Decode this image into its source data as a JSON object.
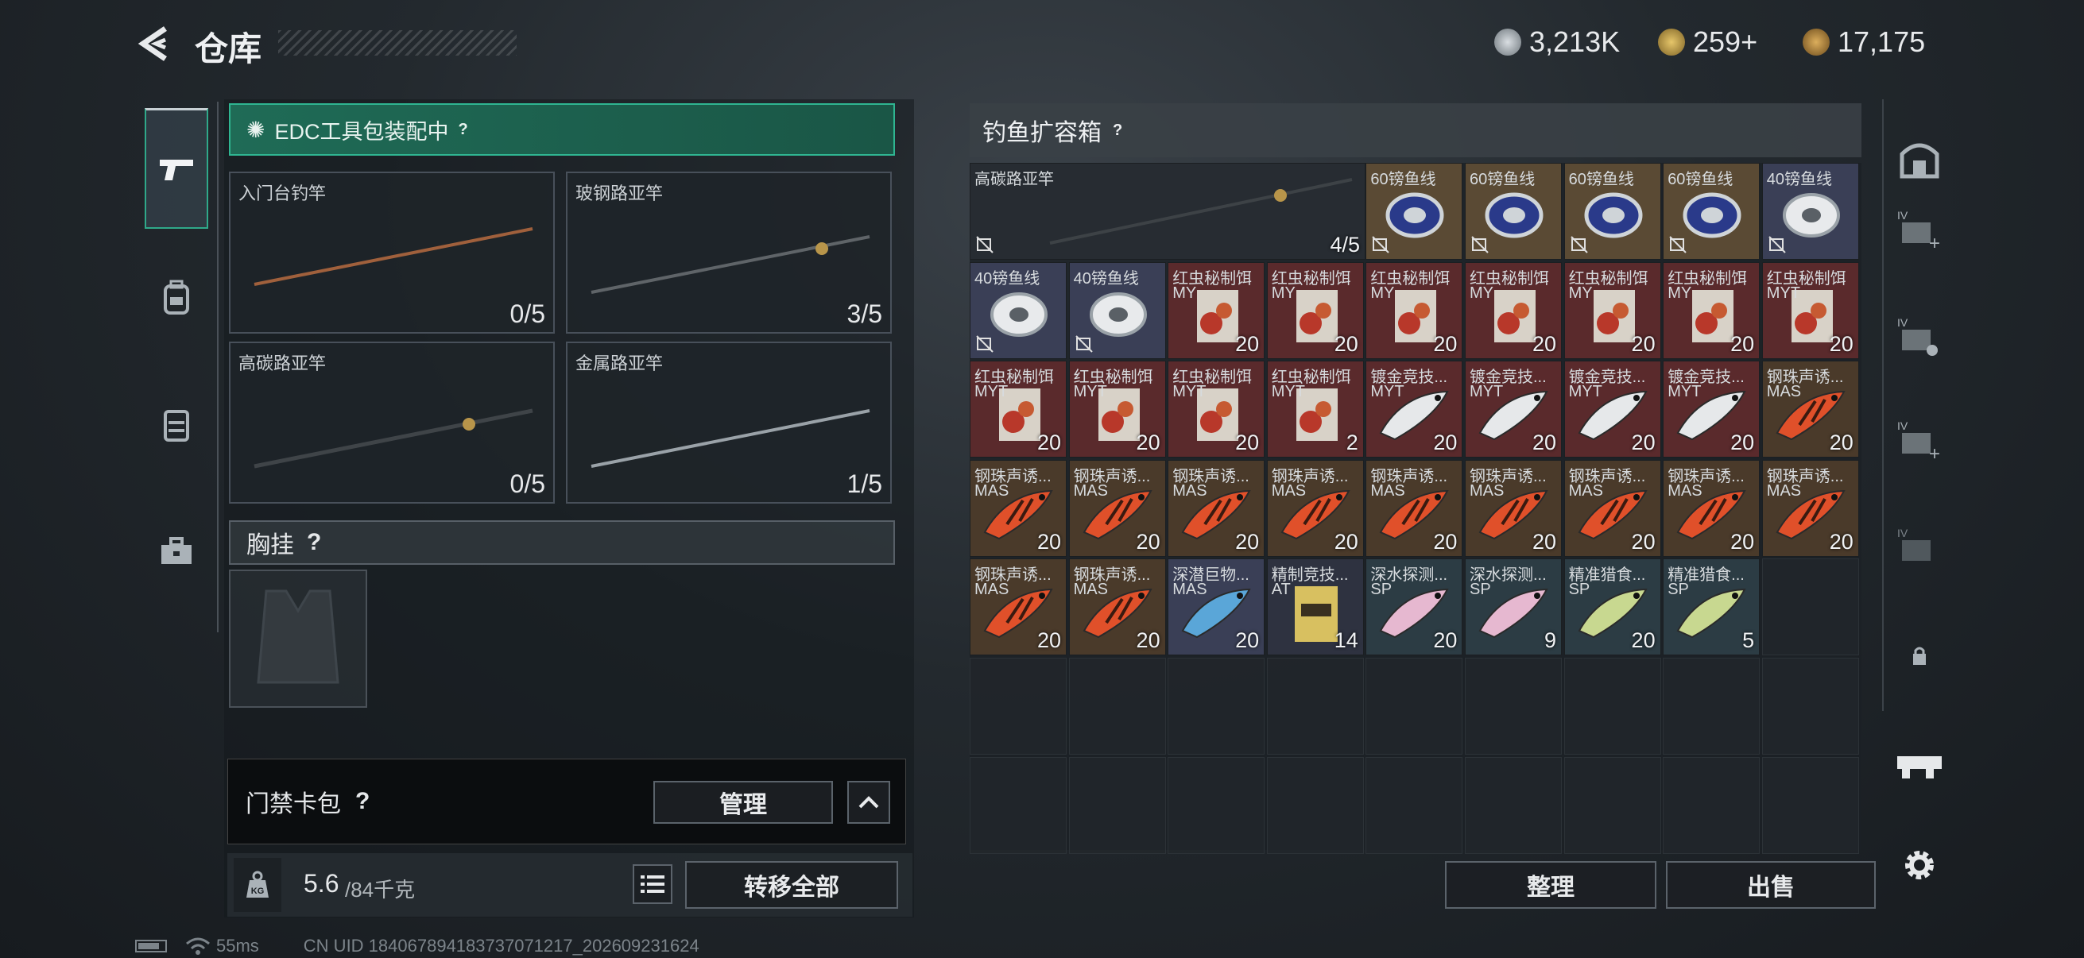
{
  "header": {
    "title": "仓库",
    "currencies": [
      {
        "icon": "silver-coin-icon",
        "value": "3,213K",
        "color": "#b8c0c8"
      },
      {
        "icon": "gold-triangle-icon",
        "value": "259+",
        "color": "#c9a54a"
      },
      {
        "icon": "bronze-coin-icon",
        "value": "17,175",
        "color": "#b5893c"
      }
    ]
  },
  "left_tabs": [
    {
      "icon": "pistol-icon",
      "active": true
    },
    {
      "icon": "backpack-icon",
      "active": false
    },
    {
      "icon": "vest-icon",
      "active": false
    },
    {
      "icon": "toolbox-icon",
      "active": false
    }
  ],
  "loadout": {
    "banner": "EDC工具包装配中",
    "help": "?",
    "rods": [
      {
        "name": "入门台钓竿",
        "count": "0/5",
        "color": "#9a5a3a"
      },
      {
        "name": "玻钢路亚竿",
        "count": "3/5",
        "color": "#5a5f63"
      },
      {
        "name": "高碳路亚竿",
        "count": "0/5",
        "color": "#3d4246"
      },
      {
        "name": "金属路亚竿",
        "count": "1/5",
        "color": "#8a9298"
      }
    ],
    "chest": {
      "label": "胸挂",
      "help": "?"
    },
    "keycard": {
      "label": "门禁卡包",
      "help": "?",
      "manage": "管理",
      "collapse_icon": "chevron-up-icon"
    },
    "weight": {
      "icon": "kg-weight-icon",
      "current": "5.6",
      "max": "/84千克",
      "list_icon": "list-icon",
      "transfer_all": "转移全部"
    }
  },
  "box": {
    "title": "钓鱼扩容箱",
    "help": "?",
    "big_item": {
      "name": "高碳路亚竿",
      "count": "4/5"
    },
    "items": [
      {
        "name": "60镑鱼线",
        "sub": "",
        "count": "",
        "type": "line60",
        "nodrop": true
      },
      {
        "name": "60镑鱼线",
        "sub": "",
        "count": "",
        "type": "line60",
        "nodrop": true
      },
      {
        "name": "60镑鱼线",
        "sub": "",
        "count": "",
        "type": "line60",
        "nodrop": true
      },
      {
        "name": "60镑鱼线",
        "sub": "",
        "count": "",
        "type": "line60",
        "nodrop": true
      },
      {
        "name": "40镑鱼线",
        "sub": "",
        "count": "",
        "type": "line40",
        "nodrop": true
      },
      {
        "name": "40镑鱼线",
        "sub": "",
        "count": "",
        "type": "line40",
        "nodrop": true
      },
      {
        "name": "40镑鱼线",
        "sub": "",
        "count": "",
        "type": "line40",
        "nodrop": true
      },
      {
        "name": "红虫秘制饵",
        "sub": "MY",
        "count": "20",
        "type": "bait",
        "nodrop": false
      },
      {
        "name": "红虫秘制饵",
        "sub": "MY",
        "count": "20",
        "type": "bait",
        "nodrop": false
      },
      {
        "name": "红虫秘制饵",
        "sub": "MY",
        "count": "20",
        "type": "bait",
        "nodrop": false
      },
      {
        "name": "红虫秘制饵",
        "sub": "MY",
        "count": "20",
        "type": "bait",
        "nodrop": false
      },
      {
        "name": "红虫秘制饵",
        "sub": "MY",
        "count": "20",
        "type": "bait",
        "nodrop": false
      },
      {
        "name": "红虫秘制饵",
        "sub": "MY",
        "count": "20",
        "type": "bait",
        "nodrop": false
      },
      {
        "name": "红虫秘制饵",
        "sub": "MYT",
        "count": "20",
        "type": "bait",
        "nodrop": false
      },
      {
        "name": "红虫秘制饵",
        "sub": "MYT",
        "count": "20",
        "type": "bait",
        "nodrop": false
      },
      {
        "name": "红虫秘制饵",
        "sub": "MYT",
        "count": "20",
        "type": "bait",
        "nodrop": false
      },
      {
        "name": "红虫秘制饵",
        "sub": "MYT",
        "count": "20",
        "type": "bait",
        "nodrop": false
      },
      {
        "name": "红虫秘制饵",
        "sub": "MYT",
        "count": "2",
        "type": "bait",
        "nodrop": false
      },
      {
        "name": "镀金竞技...",
        "sub": "MYT",
        "count": "20",
        "type": "lure-silver",
        "nodrop": false
      },
      {
        "name": "镀金竞技...",
        "sub": "MYT",
        "count": "20",
        "type": "lure-silver",
        "nodrop": false
      },
      {
        "name": "镀金竞技...",
        "sub": "MYT",
        "count": "20",
        "type": "lure-silver",
        "nodrop": false
      },
      {
        "name": "镀金竞技...",
        "sub": "MYT",
        "count": "20",
        "type": "lure-silver",
        "nodrop": false
      },
      {
        "name": "钢珠声诱...",
        "sub": "MAS",
        "count": "20",
        "type": "lure-tiger",
        "nodrop": false
      },
      {
        "name": "钢珠声诱...",
        "sub": "MAS",
        "count": "20",
        "type": "lure-tiger",
        "nodrop": false
      },
      {
        "name": "钢珠声诱...",
        "sub": "MAS",
        "count": "20",
        "type": "lure-tiger",
        "nodrop": false
      },
      {
        "name": "钢珠声诱...",
        "sub": "MAS",
        "count": "20",
        "type": "lure-tiger",
        "nodrop": false
      },
      {
        "name": "钢珠声诱...",
        "sub": "MAS",
        "count": "20",
        "type": "lure-tiger",
        "nodrop": false
      },
      {
        "name": "钢珠声诱...",
        "sub": "MAS",
        "count": "20",
        "type": "lure-tiger",
        "nodrop": false
      },
      {
        "name": "钢珠声诱...",
        "sub": "MAS",
        "count": "20",
        "type": "lure-tiger",
        "nodrop": false
      },
      {
        "name": "钢珠声诱...",
        "sub": "MAS",
        "count": "20",
        "type": "lure-tiger",
        "nodrop": false
      },
      {
        "name": "钢珠声诱...",
        "sub": "MAS",
        "count": "20",
        "type": "lure-tiger",
        "nodrop": false
      },
      {
        "name": "钢珠声诱...",
        "sub": "MAS",
        "count": "20",
        "type": "lure-tiger",
        "nodrop": false
      },
      {
        "name": "钢珠声诱...",
        "sub": "MAS",
        "count": "20",
        "type": "lure-tiger",
        "nodrop": false
      },
      {
        "name": "钢珠声诱...",
        "sub": "MAS",
        "count": "20",
        "type": "lure-tiger",
        "nodrop": false
      },
      {
        "name": "深潜巨物...",
        "sub": "MAS",
        "count": "20",
        "type": "lure-blue",
        "nodrop": false
      },
      {
        "name": "精制竞技...",
        "sub": "AT",
        "count": "14",
        "type": "bag",
        "nodrop": false
      },
      {
        "name": "深水探测...",
        "sub": "SP",
        "count": "20",
        "type": "lure-pink",
        "nodrop": false
      },
      {
        "name": "深水探测...",
        "sub": "SP",
        "count": "9",
        "type": "lure-pink",
        "nodrop": false
      },
      {
        "name": "精准猎食...",
        "sub": "SP",
        "count": "20",
        "type": "lure-green",
        "nodrop": false
      },
      {
        "name": "精准猎食...",
        "sub": "SP",
        "count": "5",
        "type": "lure-green",
        "nodrop": false
      }
    ],
    "sort_label": "整理",
    "sell_label": "出售"
  },
  "right_sidebar": [
    {
      "icon": "safe-box-icon"
    },
    {
      "icon": "add-storage-iv-icon"
    },
    {
      "icon": "storage-settings-iv-icon"
    },
    {
      "icon": "add-storage-iv-2-icon"
    },
    {
      "icon": "storage-locked-iv-icon"
    },
    {
      "icon": "lock-icon"
    },
    {
      "icon": "gun-rack-icon"
    },
    {
      "icon": "settings-gear-icon"
    }
  ],
  "status": {
    "ping": "55ms",
    "uid": "CN UID 18406789418373707121​7_202609231624"
  }
}
